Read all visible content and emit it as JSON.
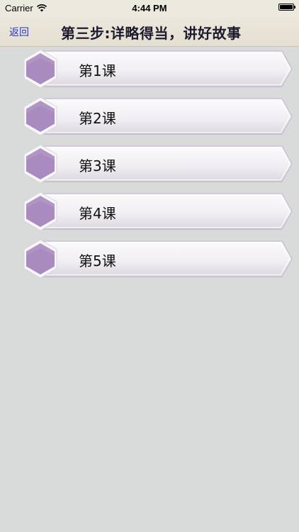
{
  "status_bar": {
    "carrier": "Carrier",
    "time": "4:44 PM"
  },
  "nav": {
    "back_label": "返回",
    "title": "第三步:详略得当，讲好故事"
  },
  "lessons": [
    {
      "label": "第1课"
    },
    {
      "label": "第2课"
    },
    {
      "label": "第3课"
    },
    {
      "label": "第4课"
    },
    {
      "label": "第5课"
    }
  ],
  "colors": {
    "background": "#d9dbda",
    "nav_background": "#e8e4d8",
    "back_link": "#2637c8",
    "hexagon": "#a98bbf"
  },
  "icons": {
    "wifi": "wifi-icon",
    "battery": "battery-icon",
    "lesson_badge": "hexagon-icon"
  }
}
